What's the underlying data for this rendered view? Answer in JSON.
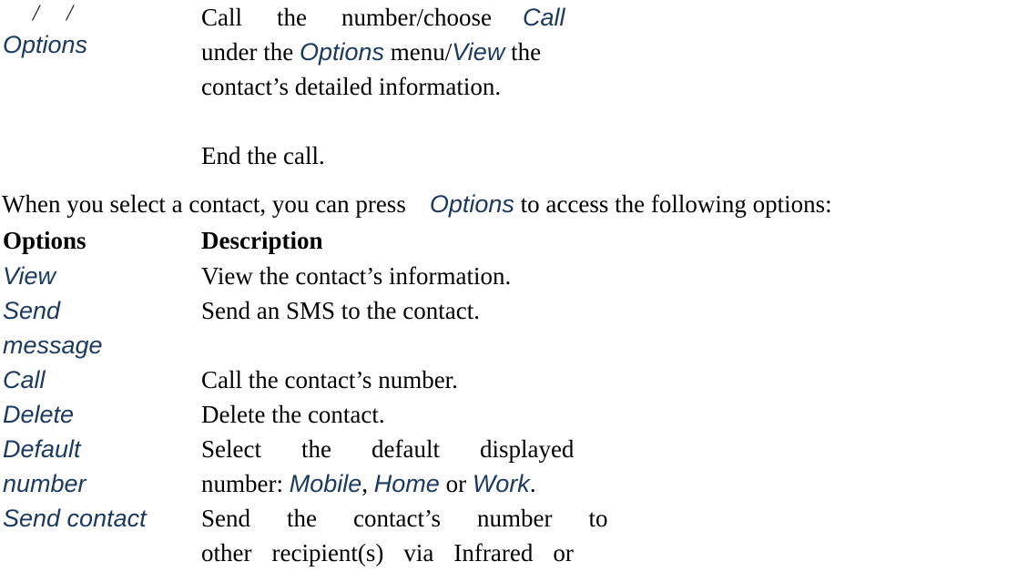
{
  "document": {
    "type": "mobile-phone-user-manual-page",
    "text_color": "#000000",
    "keyword_color": "#1b3a61"
  },
  "continued_table": {
    "rows": [
      {
        "key_icons": "/        /",
        "key_label": "Options",
        "desc_lines": [
          "Call      the      number/choose      Call",
          "under the Options menu/View the",
          "contact’s detailed information."
        ],
        "desc_plain": "Call the number/choose Call under the Options menu/View the contact’s detailed information.",
        "desc_keywords": [
          "Call",
          "Options",
          "View"
        ]
      },
      {
        "key_icons": "",
        "key_label": "",
        "desc_lines": [
          "End the call."
        ],
        "desc_plain": "End the call.",
        "desc_keywords": []
      }
    ]
  },
  "intro": {
    "before": "When you select a contact, you can press",
    "keyword": "Options",
    "after": "to access the following options:"
  },
  "options_table": {
    "headers": {
      "col1": "Options",
      "col2": "Description"
    },
    "rows": [
      {
        "option_lines": [
          "View"
        ],
        "option": "View",
        "desc_lines": [
          "View the contact’s information."
        ],
        "desc_plain": "View the contact’s information.",
        "desc_keywords": []
      },
      {
        "option_lines": [
          "Send",
          "message"
        ],
        "option": "Send message",
        "desc_lines": [
          "Send an SMS to the contact."
        ],
        "desc_plain": "Send an SMS to the contact.",
        "desc_keywords": []
      },
      {
        "option_lines": [
          "Call"
        ],
        "option": "Call",
        "desc_lines": [
          "Call the contact’s number."
        ],
        "desc_plain": "Call the contact’s number.",
        "desc_keywords": []
      },
      {
        "option_lines": [
          "Delete"
        ],
        "option": "Delete",
        "desc_lines": [
          "Delete the contact."
        ],
        "desc_plain": "Delete the contact.",
        "desc_keywords": []
      },
      {
        "option_lines": [
          "Default",
          "number"
        ],
        "option": "Default number",
        "desc_line1": "Select      the      default      displayed",
        "desc_line2_prefix": "number: ",
        "desc_kw1": "Mobile",
        "desc_sep1": ", ",
        "desc_kw2": "Home",
        "desc_sep2": " or ",
        "desc_kw3": "Work",
        "desc_suffix": ".",
        "desc_plain": "Select the default displayed number: Mobile, Home or Work.",
        "desc_keywords": [
          "Mobile",
          "Home",
          "Work"
        ]
      },
      {
        "option_lines": [
          "Send contact"
        ],
        "option": "Send contact",
        "desc_lines": [
          "Send     the     contact’s     number     to",
          "other   recipient(s)   via   Infrared   or"
        ],
        "desc_plain": "Send the contact’s number to other recipient(s) via Infrared or",
        "desc_keywords": []
      }
    ]
  }
}
